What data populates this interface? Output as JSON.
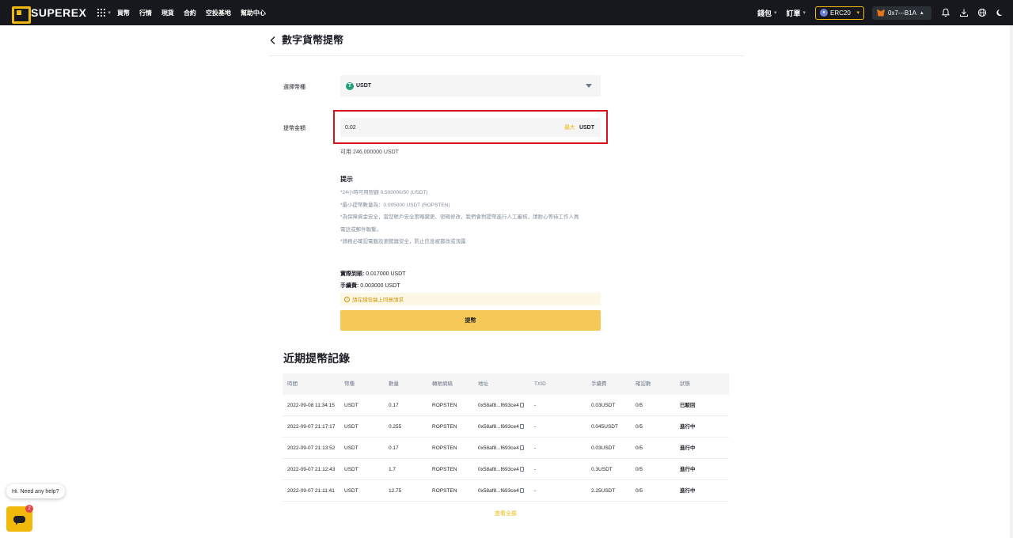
{
  "nav": {
    "brand": "SUPEREX",
    "links": [
      "買幣",
      "行情",
      "現貨",
      "合約",
      "空投基地",
      "幫助中心"
    ],
    "wallet_menu": "錢包",
    "orders_menu": "訂單",
    "network": "ERC20",
    "network_icon": "ethereum-icon",
    "wallet_address": "0x7---B1A"
  },
  "page": {
    "title": "數字貨幣提幣"
  },
  "form": {
    "coin_label": "選擇幣種",
    "coin_value": "USDT",
    "coin_icon_glyph": "T",
    "amount_label": "提幣金額",
    "amount_value": "0.02",
    "max_label": "最大",
    "amount_unit": "USDT",
    "available": "可用 246.000000 USDT"
  },
  "tips": {
    "title": "提示",
    "lines": [
      "*24小時可用限額 0.500000/50 (USDT)",
      "*最小提幣數量為：0.005000 USDT (ROPSTEN)",
      "*為保障資金安全，當您賬戶安全策略變更、密碼修改，我們會對提幣進行人工審核，請耐心等待工作人員",
      "電話或郵件聯繫。",
      "*請務必確認電腦及瀏覽器安全，防止信息被篡改或洩露"
    ]
  },
  "summary": {
    "received_label": "實際到賬:",
    "received_value": "0.017000 USDT",
    "fee_label": "手續費:",
    "fee_value": "0.003000 USDT",
    "notice": "請在錢包端上同意請求",
    "notice_icon_glyph": "!",
    "submit_label": "提幣"
  },
  "history": {
    "title": "近期提幣記錄",
    "columns": [
      "時間",
      "幣種",
      "數量",
      "轉賬網絡",
      "地址",
      "TXID",
      "手續費",
      "確認數",
      "狀態"
    ],
    "rows": [
      [
        "2022-09-08 11:34:15",
        "USDT",
        "0.17",
        "ROPSTEN",
        "0x58af8...f693ce4",
        "-",
        "0.03USDT",
        "0/5",
        "已駁回"
      ],
      [
        "2022-09-07 21:17:17",
        "USDT",
        "0.255",
        "ROPSTEN",
        "0x58af8...f693ce4",
        "-",
        "0.045USDT",
        "0/5",
        "進行中"
      ],
      [
        "2022-09-07 21:13:52",
        "USDT",
        "0.17",
        "ROPSTEN",
        "0x58af8...f693ce4",
        "-",
        "0.03USDT",
        "0/5",
        "進行中"
      ],
      [
        "2022-09-07 21:12:43",
        "USDT",
        "1.7",
        "ROPSTEN",
        "0x58af8...f693ce4",
        "-",
        "0.3USDT",
        "0/5",
        "進行中"
      ],
      [
        "2022-09-07 21:11:41",
        "USDT",
        "12.75",
        "ROPSTEN",
        "0x58af8...f693ce4",
        "-",
        "2.25USDT",
        "0/5",
        "進行中"
      ]
    ],
    "view_all": "查看全部"
  },
  "help": {
    "bubble": "Hi. Need any help?",
    "badge_count": "2"
  },
  "colors": {
    "accent": "#f0b90b",
    "topbar": "#16181d",
    "highlight": "#d9121b",
    "usdt": "#26a17b"
  }
}
